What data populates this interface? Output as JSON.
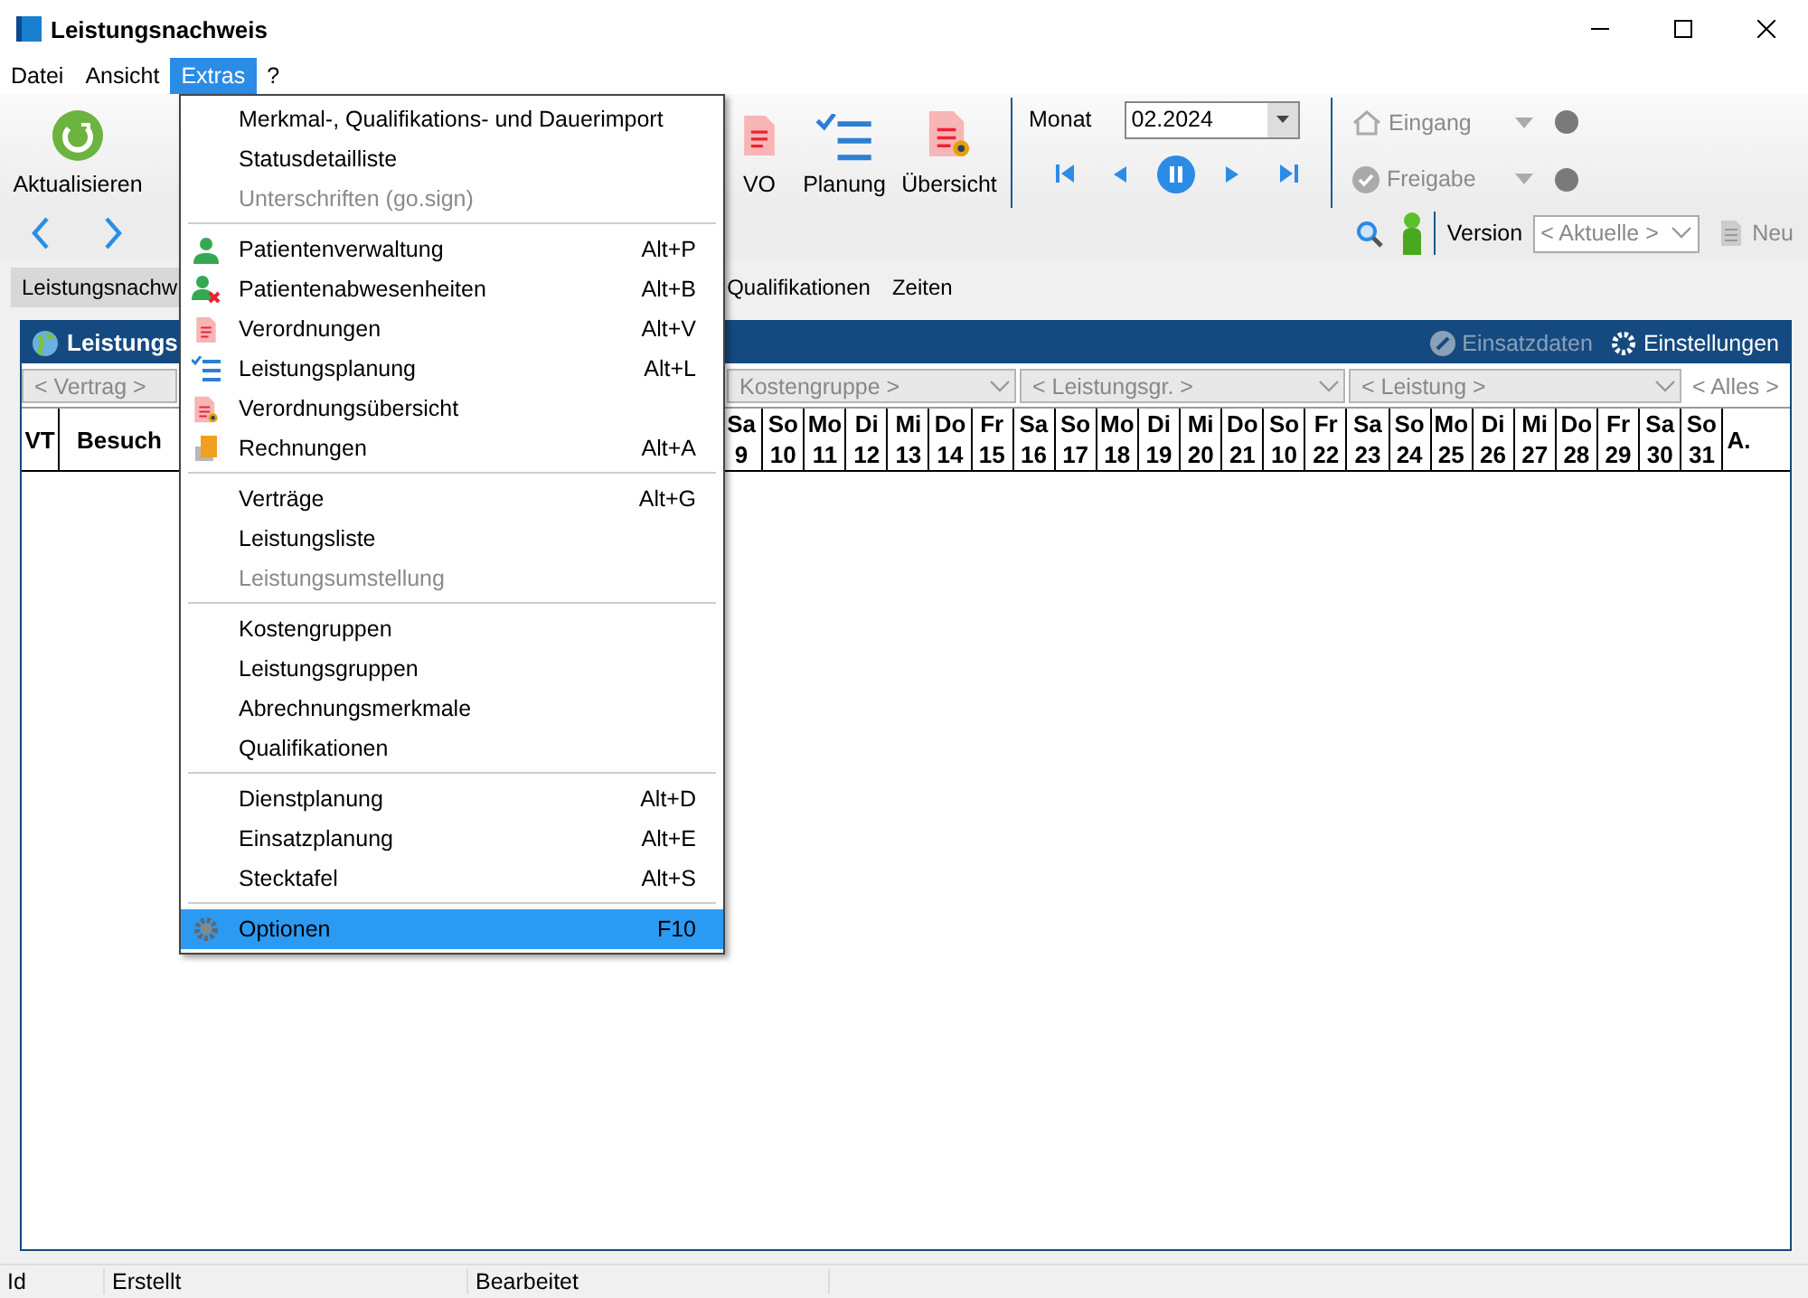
{
  "window": {
    "title": "Leistungsnachweis"
  },
  "menubar": [
    {
      "label": "Datei",
      "selected": false
    },
    {
      "label": "Ansicht",
      "selected": false
    },
    {
      "label": "Extras",
      "selected": true
    },
    {
      "label": "?",
      "selected": false
    }
  ],
  "menu": {
    "groups": [
      [
        {
          "label": "Merkmal-, Qualifikations- und Dauerimport",
          "disabled": false,
          "selected": false
        },
        {
          "label": "Statusdetailliste",
          "disabled": false,
          "selected": false
        },
        {
          "label": "Unterschriften (go.sign)",
          "disabled": true,
          "selected": false
        }
      ],
      [
        {
          "label": "Patientenverwaltung",
          "shortcut": "Alt+P",
          "disabled": false,
          "selected": false
        },
        {
          "label": "Patientenabwesenheiten",
          "shortcut": "Alt+B",
          "disabled": false,
          "selected": false
        },
        {
          "label": "Verordnungen",
          "shortcut": "Alt+V",
          "disabled": false,
          "selected": false
        },
        {
          "label": "Leistungsplanung",
          "shortcut": "Alt+L",
          "disabled": false,
          "selected": false
        },
        {
          "label": "Verordnungsübersicht",
          "disabled": false,
          "selected": false
        },
        {
          "label": "Rechnungen",
          "shortcut": "Alt+A",
          "disabled": false,
          "selected": false
        }
      ],
      [
        {
          "label": "Verträge",
          "shortcut": "Alt+G",
          "disabled": false,
          "selected": false
        },
        {
          "label": "Leistungsliste",
          "disabled": false,
          "selected": false
        },
        {
          "label": "Leistungsumstellung",
          "disabled": true,
          "selected": false
        }
      ],
      [
        {
          "label": "Kostengruppen",
          "disabled": false,
          "selected": false
        },
        {
          "label": "Leistungsgruppen",
          "disabled": false,
          "selected": false
        },
        {
          "label": "Abrechnungsmerkmale",
          "disabled": false,
          "selected": false
        },
        {
          "label": "Qualifikationen",
          "disabled": false,
          "selected": false
        }
      ],
      [
        {
          "label": "Dienstplanung",
          "shortcut": "Alt+D",
          "disabled": false,
          "selected": false
        },
        {
          "label": "Einsatzplanung",
          "shortcut": "Alt+E",
          "disabled": false,
          "selected": false
        },
        {
          "label": "Stecktafel",
          "shortcut": "Alt+S",
          "disabled": false,
          "selected": false
        }
      ],
      [
        {
          "label": "Optionen",
          "shortcut": "F10",
          "disabled": false,
          "selected": true
        }
      ]
    ]
  },
  "toolbar": {
    "refresh": "Aktualisieren",
    "buttons": [
      "VO",
      "Planung",
      "Übersicht"
    ],
    "month_label": "Monat",
    "month_value": "02.2024",
    "status": [
      {
        "label": "Eingang",
        "disabled": true
      },
      {
        "label": "Freigabe",
        "disabled": true
      }
    ],
    "version_label": "Version",
    "version_value": "< Aktuelle >",
    "new": {
      "label": "Neu",
      "disabled": true
    }
  },
  "tabs": [
    {
      "label": "Leistungsnachw",
      "selected": true
    },
    {
      "label": "Qualifikationen",
      "selected": false
    },
    {
      "label": "Zeiten",
      "selected": false
    }
  ],
  "panel": {
    "title": "Leistungs",
    "actions": [
      {
        "label": "Einsatzdaten",
        "disabled": true
      },
      {
        "label": "Einstellungen",
        "disabled": false
      }
    ],
    "filters": [
      "< Vertrag >",
      "Kostengruppe >",
      "< Leistungsgr. >",
      "< Leistung >"
    ],
    "filter_all": "< Alles >",
    "columns": [
      "VT",
      "Besuch"
    ],
    "days": [
      [
        "Sa",
        "9"
      ],
      [
        "So",
        "10"
      ],
      [
        "Mo",
        "11"
      ],
      [
        "Di",
        "12"
      ],
      [
        "Mi",
        "13"
      ],
      [
        "Do",
        "14"
      ],
      [
        "Fr",
        "15"
      ],
      [
        "Sa",
        "16"
      ],
      [
        "So",
        "17"
      ],
      [
        "Mo",
        "18"
      ],
      [
        "Di",
        "19"
      ],
      [
        "Mi",
        "20"
      ],
      [
        "Do",
        "21"
      ],
      [
        "So",
        "10"
      ],
      [
        "Fr",
        "22"
      ],
      [
        "Sa",
        "23"
      ],
      [
        "So",
        "24"
      ],
      [
        "Mo",
        "25"
      ],
      [
        "Di",
        "26"
      ],
      [
        "Mi",
        "27"
      ],
      [
        "Do",
        "28"
      ],
      [
        "Fr",
        "29"
      ],
      [
        "Sa",
        "30"
      ],
      [
        "So",
        "31"
      ]
    ],
    "last_column": "A."
  },
  "status_bar": [
    "Id",
    "Erstellt",
    "Bearbeitet"
  ]
}
